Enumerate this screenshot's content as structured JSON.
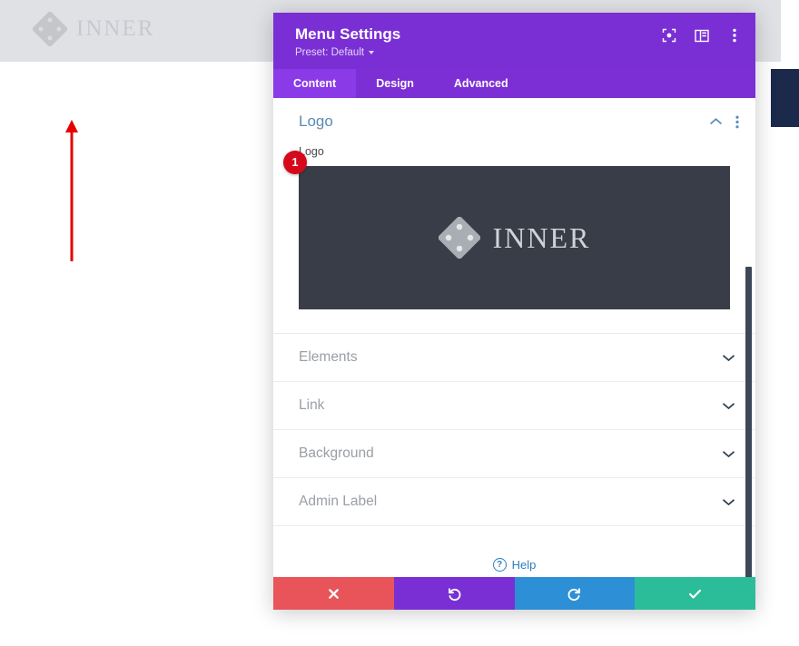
{
  "background": {
    "site_logo_text": "INNER",
    "logo_icon": "diamond-cluster-icon",
    "annotation_arrow": "red-up-arrow-annotation"
  },
  "modal": {
    "title": "Menu Settings",
    "preset_label": "Preset: Default",
    "header_icons": [
      {
        "name": "focus-icon",
        "label": "Focus"
      },
      {
        "name": "layout-split-icon",
        "label": "Layout"
      },
      {
        "name": "more-vertical-icon",
        "label": "More"
      }
    ],
    "tabs": [
      {
        "label": "Content",
        "active": true
      },
      {
        "label": "Design",
        "active": false
      },
      {
        "label": "Advanced",
        "active": false
      }
    ],
    "open_section": {
      "title": "Logo",
      "collapse_icon": "chevron-up-icon",
      "menu_icon": "more-vertical-icon",
      "field_label": "Logo",
      "image": {
        "logo_text": "INNER",
        "logo_icon": "diamond-cluster-icon",
        "badge": "1"
      }
    },
    "sections": [
      {
        "label": "Elements",
        "icon": "chevron-down-icon"
      },
      {
        "label": "Link",
        "icon": "chevron-down-icon"
      },
      {
        "label": "Background",
        "icon": "chevron-down-icon"
      },
      {
        "label": "Admin Label",
        "icon": "chevron-down-icon"
      }
    ],
    "help": {
      "label": "Help",
      "icon": "question-circle-icon"
    },
    "actions": [
      {
        "name": "cancel",
        "icon": "close-x-icon",
        "color": "#e8545a"
      },
      {
        "name": "undo",
        "icon": "undo-arrow-icon",
        "color": "#7a2fd4"
      },
      {
        "name": "redo",
        "icon": "redo-arrow-icon",
        "color": "#2d8fd5"
      },
      {
        "name": "save",
        "icon": "checkmark-icon",
        "color": "#2bbd9a"
      }
    ],
    "scrollbar": "vertical-scrollbar"
  },
  "colors": {
    "header_purple": "#7a2fd4",
    "tab_active_purple": "#8b3ae8",
    "badge_red": "#d6081b",
    "logo_box_dark": "#383d47",
    "navy_block": "#1b2a4a"
  }
}
